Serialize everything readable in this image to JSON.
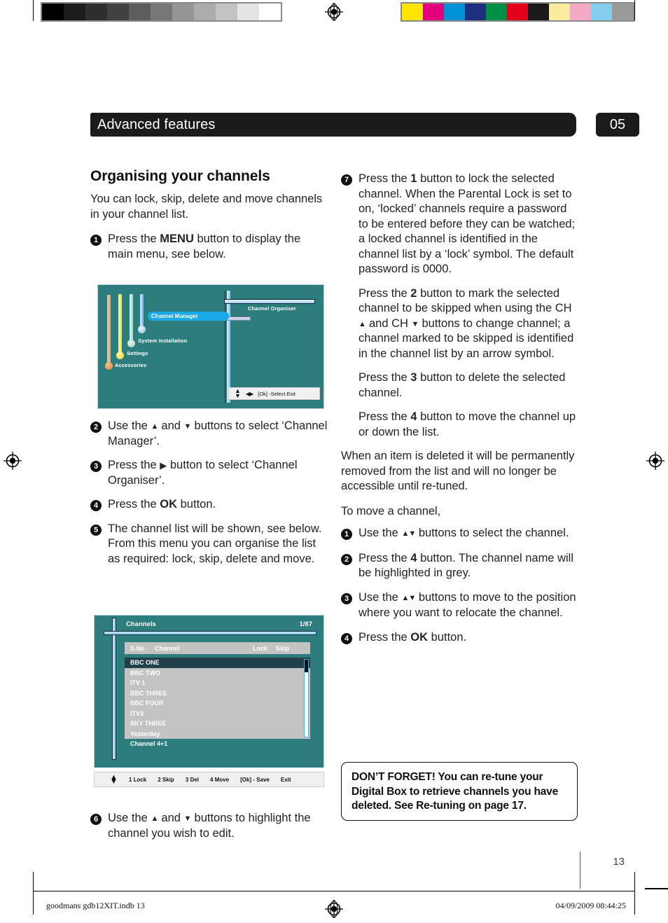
{
  "header": {
    "title": "Advanced features",
    "chapter": "05"
  },
  "left_column": {
    "section_title": "Organising your channels",
    "intro": "You can lock, skip, delete and move channels in your channel list.",
    "steps": [
      {
        "num": "1",
        "text_html": "Press the <b>MENU</b> button to display the main menu, see below."
      },
      {
        "num": "2",
        "text_html": "Use the <span class=\"arw\">▲</span> and <span class=\"arw\">▼</span> buttons to select ‘Channel Manager’."
      },
      {
        "num": "3",
        "text_html": "Press the <span class=\"arwr\">▶</span> button to select ‘Channel Organiser’."
      },
      {
        "num": "4",
        "text_html": "Press the <b>OK</b> button."
      },
      {
        "num": "5",
        "text_html": "The channel list will be shown, see below. From this menu you can organise the list as required: lock, skip, delete and move."
      },
      {
        "num": "6",
        "text_html": "Use the <span class=\"arw\">▲</span> and <span class=\"arw\">▼</span> buttons to highlight the channel you wish to edit."
      }
    ]
  },
  "right_column": {
    "step7": {
      "num": "7",
      "para1_html": "Press the <b>1</b> button to lock the selected channel. When the Parental Lock is set to on, ‘locked’ channels require a password to be entered before they can be watched; a locked channel is identified in the channel list by a ‘lock’ symbol. The default password is 0000.",
      "para2_html": "Press the <b>2</b> button to mark the selected channel to be skipped when using the CH <span class=\"arw\">▲</span> and CH <span class=\"arw\">▼</span> buttons to change channel; a channel marked to be skipped is identified in the channel list by an arrow symbol.",
      "para3_html": "Press the <b>3</b> button to delete the selected channel.",
      "para4_html": "Press the <b>4</b> button to move the channel up or down the list."
    },
    "note_deleted": "When an item is deleted it will be permanently removed from the list and will no longer be accessible until re-tuned.",
    "move_intro": "To move a channel,",
    "move_steps": [
      {
        "num": "1",
        "text_html": "Use the <span class=\"arw-pair\">▲▼</span> buttons to select the channel."
      },
      {
        "num": "2",
        "text_html": "Press the <b>4</b> button. The channel name will be highlighted in grey."
      },
      {
        "num": "3",
        "text_html": "Use the <span class=\"arw-pair\">▲▼</span> buttons to move to the position where you want to relocate the channel."
      },
      {
        "num": "4",
        "text_html": "Press the <b>OK</b> button."
      }
    ],
    "dont_forget": "DON’T FORGET!  You can re-tune your Digital Box to retrieve channels you have deleted. See Re-tuning on page 17."
  },
  "tv_main_menu": {
    "menu_items": [
      {
        "label": "Channel Manager",
        "selected": true,
        "node_color": "#8fd0f2",
        "bar_color": "#8fd0f2"
      },
      {
        "label": "System Installation",
        "selected": false,
        "node_color": "#bfe3cf",
        "bar_color": "#bfe3cf"
      },
      {
        "label": "Settings",
        "selected": false,
        "node_color": "#f2e33c",
        "bar_color": "#f2e33c"
      },
      {
        "label": "Accessories",
        "selected": false,
        "node_color": "#e8943f",
        "bar_color": "#e6b58c"
      }
    ],
    "submenu_label": "Channel Organiser",
    "status_bar": {
      "updown_icon": "up-down-arrow-icon",
      "leftright_icon": "left-right-arrow-icon",
      "hint": "[Ok] -Select   Exit"
    }
  },
  "tv_channel_list": {
    "title": "Channels",
    "count": "1/87",
    "columns": [
      "S.No",
      "Channel",
      "Lock",
      "Skip"
    ],
    "rows": [
      "BBC ONE",
      "BBC TWO",
      "ITV 1",
      "BBC THREE",
      "BBC FOUR",
      "ITV3",
      "SKY THREE",
      "Yesterday",
      "Channel 4+1"
    ],
    "selected_row": "BBC ONE",
    "footer_items": [
      "1 Lock",
      "2 Skip",
      "3 Del",
      "4 Move",
      "[Ok] - Save",
      "Exit"
    ]
  },
  "page_footer": {
    "page_number": "13",
    "file_name": "goodmans gdb12XIT.indb   13",
    "timestamp": "04/09/2009   08:44:25"
  },
  "calibration": {
    "gray_swatches": [
      "#000000",
      "#1c1c1c",
      "#2e2e2e",
      "#414141",
      "#5d5d5d",
      "#777777",
      "#959595",
      "#acacac",
      "#c3c3c3",
      "#e4e4e4",
      "#ffffff"
    ],
    "color_swatches": [
      "#ffe400",
      "#e2007d",
      "#0091d6",
      "#1d2f7f",
      "#009045",
      "#e2001a",
      "#1a1a1a",
      "#fbeba0",
      "#f3a8c3",
      "#83cdef",
      "#9a9a9a"
    ]
  }
}
